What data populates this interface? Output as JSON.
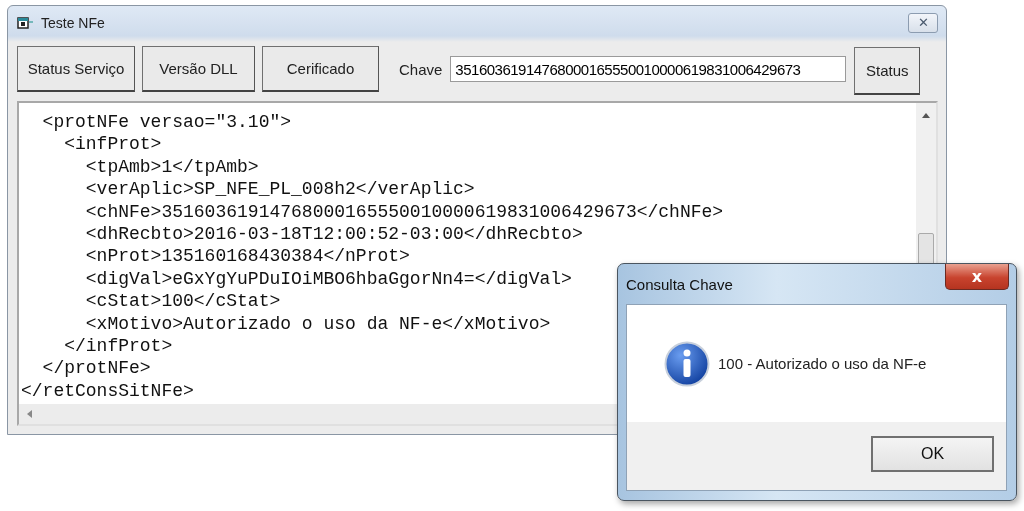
{
  "window": {
    "title": "Teste NFe",
    "close": "✕"
  },
  "toolbar": {
    "buttons": [
      {
        "label": "Status Serviço"
      },
      {
        "label": "Versão DLL"
      },
      {
        "label": "Cerificado"
      }
    ],
    "key_label": "Chave",
    "key_value": "35160361914768000165550010000619831006429673",
    "status_button": "Status"
  },
  "xml_lines": [
    {
      "children": [
        {
          "text": "<protNFe versao=\"3.10\">",
          "children": [
            {
              "text": "<infProt>",
              "children": [
                {
                  "text": "<tpAmb>1</tpAmb>"
                },
                {
                  "text": "<verAplic>SP_NFE_PL_008h2</verAplic>"
                },
                {
                  "text": "<chNFe>35160361914768000165550010000619831006429673</chNFe>"
                },
                {
                  "text": "<dhRecbto>2016-03-18T12:00:52-03:00</dhRecbto>"
                },
                {
                  "text": "<nProt>135160168430384</nProt>"
                },
                {
                  "text": "<digVal>eGxYgYuPDuIOiMBO6hbaGgorNn4=</digVal>"
                },
                {
                  "text": "<cStat>100</cStat>"
                },
                {
                  "text": "<xMotivo>Autorizado o uso da NF-e</xMotivo>"
                }
              ]
            },
            {
              "text": "</infProt>"
            }
          ]
        },
        {
          "text": "</protNFe>"
        }
      ]
    },
    {
      "text": "</retConsSitNFe>"
    }
  ],
  "dialog": {
    "title": "Consulta Chave",
    "close": "x",
    "message": "100 - Autorizado o uso da NF-e",
    "button": "OK"
  }
}
